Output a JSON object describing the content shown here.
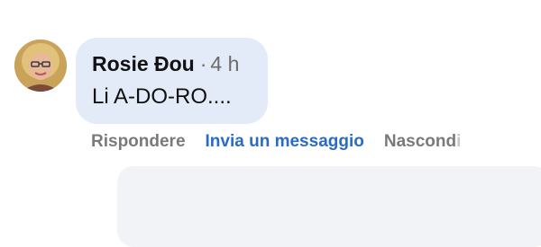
{
  "comment": {
    "author": "Rosie Đou",
    "separator": "·",
    "timestamp": "4 h",
    "text": "Li A-DO-RO...."
  },
  "actions": {
    "reply_label": "Rispondere",
    "message_label": "Invia un messaggio",
    "hide_label_main": "Nascond",
    "hide_label_fade": "i"
  },
  "colors": {
    "bubble_bg": "#e3ebf8",
    "link_blue": "#2a6bc7",
    "muted_gray": "#7a7a7a"
  }
}
